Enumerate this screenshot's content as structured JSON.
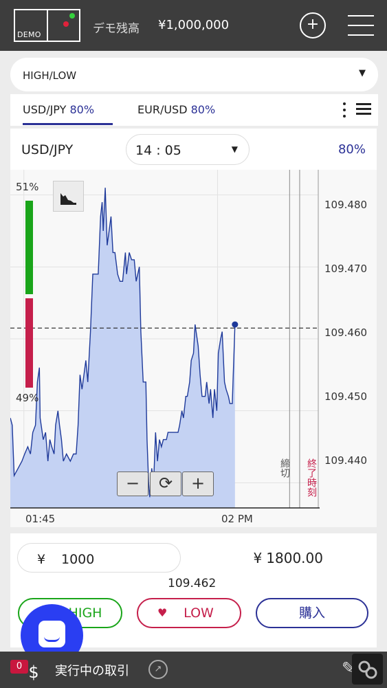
{
  "header": {
    "logo_text": "DEMO",
    "balance_label": "デモ残高",
    "balance_value": "¥1,000,000",
    "add_button_glyph": "+",
    "menu_icon": "hamburger-icon"
  },
  "option_type": {
    "value": "HIGH/LOW",
    "caret": "▼"
  },
  "pair_tabs": [
    {
      "pair": "USD/JPY",
      "payout": "80%",
      "active": true
    },
    {
      "pair": "EUR/USD",
      "payout": "80%",
      "active": false
    }
  ],
  "asset_header": {
    "asset": "USD/JPY",
    "expiry_time": "14 : 05",
    "caret": "▼",
    "payout": "80%"
  },
  "sentiment": {
    "high_pct": "51%",
    "low_pct": "49%",
    "high_fraction": 0.51,
    "low_fraction": 0.49
  },
  "chart_data": {
    "type": "area",
    "y_ticks": [
      "109.480",
      "109.470",
      "109.460",
      "109.450",
      "109.440"
    ],
    "ylim": [
      109.4365,
      109.4835
    ],
    "x_ticks": [
      "01:45",
      "02 PM"
    ],
    "x_range_minutes": [
      -0.35,
      7.6
    ],
    "strike_rate": 109.4615,
    "current_rate": 109.462,
    "deadline_label": "締切",
    "expiry_label": "終了時刻",
    "deadline_minute": 6.86,
    "expiry_minute": 7.12,
    "series": [
      {
        "values": [
          [
            -0.35,
            109.449
          ],
          [
            -0.3,
            109.448
          ],
          [
            -0.25,
            109.441
          ],
          [
            -0.15,
            109.442
          ],
          [
            -0.05,
            109.443
          ],
          [
            0.02,
            109.444
          ],
          [
            0.1,
            109.445
          ],
          [
            0.17,
            109.444
          ],
          [
            0.23,
            109.447
          ],
          [
            0.3,
            109.448
          ],
          [
            0.35,
            109.454
          ],
          [
            0.4,
            109.456
          ],
          [
            0.42,
            109.449
          ],
          [
            0.5,
            109.446
          ],
          [
            0.56,
            109.447
          ],
          [
            0.62,
            109.443
          ],
          [
            0.67,
            109.446
          ],
          [
            0.72,
            109.445
          ],
          [
            0.78,
            109.444
          ],
          [
            0.82,
            109.448
          ],
          [
            0.88,
            109.45
          ],
          [
            0.92,
            109.448
          ],
          [
            0.97,
            109.446
          ],
          [
            1.02,
            109.443
          ],
          [
            1.1,
            109.444
          ],
          [
            1.2,
            109.443
          ],
          [
            1.28,
            109.444
          ],
          [
            1.35,
            109.444
          ],
          [
            1.4,
            109.448
          ],
          [
            1.45,
            109.455
          ],
          [
            1.5,
            109.453
          ],
          [
            1.55,
            109.455
          ],
          [
            1.6,
            109.457
          ],
          [
            1.65,
            109.454
          ],
          [
            1.72,
            109.461
          ],
          [
            1.78,
            109.469
          ],
          [
            1.85,
            109.469
          ],
          [
            1.92,
            109.469
          ],
          [
            1.98,
            109.477
          ],
          [
            2.02,
            109.479
          ],
          [
            2.05,
            109.475
          ],
          [
            2.1,
            109.481
          ],
          [
            2.15,
            109.473
          ],
          [
            2.2,
            109.475
          ],
          [
            2.25,
            109.477
          ],
          [
            2.3,
            109.472
          ],
          [
            2.35,
            109.472
          ],
          [
            2.42,
            109.469
          ],
          [
            2.48,
            109.468
          ],
          [
            2.55,
            109.468
          ],
          [
            2.62,
            109.472
          ],
          [
            2.65,
            109.469
          ],
          [
            2.72,
            109.472
          ],
          [
            2.78,
            109.471
          ],
          [
            2.85,
            109.471
          ],
          [
            2.9,
            109.468
          ],
          [
            2.98,
            109.47
          ],
          [
            3.02,
            109.461
          ],
          [
            3.08,
            109.454
          ],
          [
            3.15,
            109.454
          ],
          [
            3.18,
            109.446
          ],
          [
            3.22,
            109.44
          ],
          [
            3.25,
            109.438
          ],
          [
            3.3,
            109.442
          ],
          [
            3.35,
            109.44
          ],
          [
            3.4,
            109.447
          ],
          [
            3.45,
            109.443
          ],
          [
            3.5,
            109.446
          ],
          [
            3.55,
            109.445
          ],
          [
            3.6,
            109.446
          ],
          [
            3.68,
            109.446
          ],
          [
            3.72,
            109.447
          ],
          [
            3.78,
            109.447
          ],
          [
            3.85,
            109.447
          ],
          [
            3.92,
            109.447
          ],
          [
            3.98,
            109.447
          ],
          [
            4.02,
            109.448
          ],
          [
            4.08,
            109.45
          ],
          [
            4.12,
            109.449
          ],
          [
            4.18,
            109.452
          ],
          [
            4.22,
            109.452
          ],
          [
            4.28,
            109.454
          ],
          [
            4.32,
            109.457
          ],
          [
            4.38,
            109.458
          ],
          [
            4.42,
            109.462
          ],
          [
            4.5,
            109.459
          ],
          [
            4.55,
            109.455
          ],
          [
            4.6,
            109.452
          ],
          [
            4.68,
            109.452
          ],
          [
            4.72,
            109.454
          ],
          [
            4.78,
            109.451
          ],
          [
            4.82,
            109.453
          ],
          [
            4.88,
            109.449
          ],
          [
            4.92,
            109.453
          ],
          [
            4.98,
            109.45
          ],
          [
            5.02,
            109.458
          ],
          [
            5.08,
            109.46
          ],
          [
            5.12,
            109.461
          ],
          [
            5.18,
            109.454
          ],
          [
            5.22,
            109.453
          ],
          [
            5.28,
            109.452
          ],
          [
            5.32,
            109.451
          ],
          [
            5.38,
            109.451
          ],
          [
            5.45,
            109.462
          ]
        ]
      }
    ]
  },
  "zoom_controls": [
    "−",
    "⟳",
    "+"
  ],
  "trade": {
    "currency": "¥",
    "amount": "1000",
    "payout_currency": "¥",
    "payout": "1800.00",
    "rate": "109.462",
    "high_label": "HIGH",
    "low_label": "LOW",
    "low_glyph": "♥",
    "buy_label": "購入"
  },
  "bottom_bar": {
    "badge_count": "0",
    "label": "実行中の取引"
  },
  "colors": {
    "accent": "#2b3196",
    "high": "#1aa51a",
    "low": "#c51f4b",
    "chat": "#2a3ef2"
  }
}
